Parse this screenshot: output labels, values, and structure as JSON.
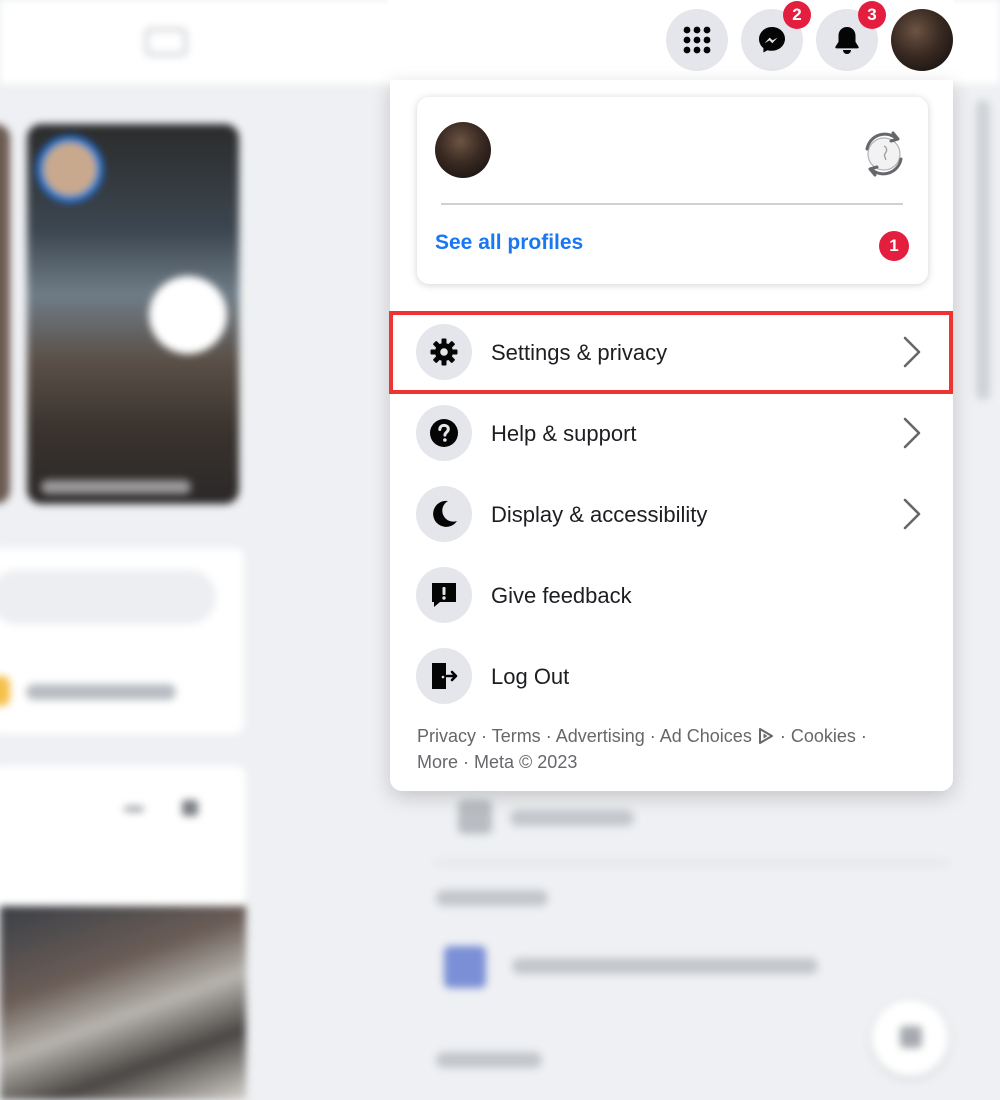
{
  "header": {
    "messenger_badge": "2",
    "notifications_badge": "3"
  },
  "profile_card": {
    "name": "",
    "see_all_label": "See all profiles",
    "see_all_badge": "1"
  },
  "menu_items": [
    {
      "label": "Settings & privacy",
      "icon": "gear-icon",
      "has_chevron": true
    },
    {
      "label": "Help & support",
      "icon": "question-icon",
      "has_chevron": true
    },
    {
      "label": "Display & accessibility",
      "icon": "moon-icon",
      "has_chevron": true
    },
    {
      "label": "Give feedback",
      "icon": "feedback-icon",
      "has_chevron": false
    },
    {
      "label": "Log Out",
      "icon": "logout-icon",
      "has_chevron": false
    }
  ],
  "footer": {
    "privacy": "Privacy",
    "terms": "Terms",
    "advertising": "Advertising",
    "ad_choices": "Ad Choices",
    "cookies": "Cookies",
    "more": "More",
    "meta": "Meta © 2023",
    "sep": " · "
  },
  "colors": {
    "accent": "#1877f2",
    "badge": "#e41e3f",
    "highlight_box": "#ee3333"
  }
}
